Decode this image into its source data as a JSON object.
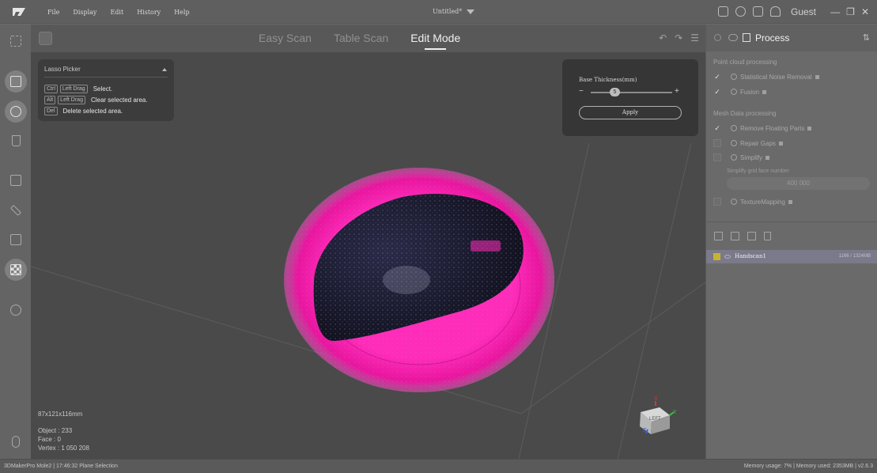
{
  "app": {
    "menu": [
      "File",
      "Display",
      "Edit",
      "History",
      "Help"
    ],
    "doc_title": "Untitled*",
    "user": "Guest"
  },
  "modes": {
    "easy_scan": "Easy Scan",
    "table_scan": "Table Scan",
    "edit_mode": "Edit Mode",
    "active": "Edit Mode"
  },
  "lasso": {
    "title": "Lasso Picker",
    "rows": [
      {
        "keys": [
          "Ctrl",
          "Left Drag"
        ],
        "desc": "Select."
      },
      {
        "keys": [
          "Alt",
          "Left Drag"
        ],
        "desc": "Clear selected area."
      },
      {
        "keys": [
          "Del"
        ],
        "desc": "Delete selected area."
      }
    ]
  },
  "thickness": {
    "label": "Base Thickness(mm)",
    "value": "5",
    "minus": "−",
    "plus": "+",
    "apply": "Apply"
  },
  "info": {
    "dimensions": "87x121x116mm",
    "object": "Object : 233",
    "face": "Face : 0",
    "vertex": "Vertex : 1 050 208"
  },
  "panel": {
    "title": "Process",
    "section_point_cloud": "Point cloud processing",
    "statistical_noise": "Statistical Noise Removal",
    "fusion": "Fusion",
    "section_mesh": "Mesh Data processing",
    "remove_floating": "Remove Floating Parts",
    "repair_gaps": "Repair Gaps",
    "simplify": "Simplify",
    "simplify_label": "Simplify grid face number",
    "simplify_value": "400 000",
    "texture_mapping": "TextureMapping"
  },
  "scans": [
    {
      "name": "Handscan1",
      "size": "1166 / 1324MB"
    }
  ],
  "status": {
    "left": "3DMakerPro Mole2 | 17:46:32 Plane Selection",
    "right": "Memory usage: 7% | Memory used: 2353MB | v2.6.3"
  },
  "colors": {
    "selection": "#ff1fb4",
    "object": "#1c1c34",
    "scan_swatch": "#c7b42e"
  }
}
